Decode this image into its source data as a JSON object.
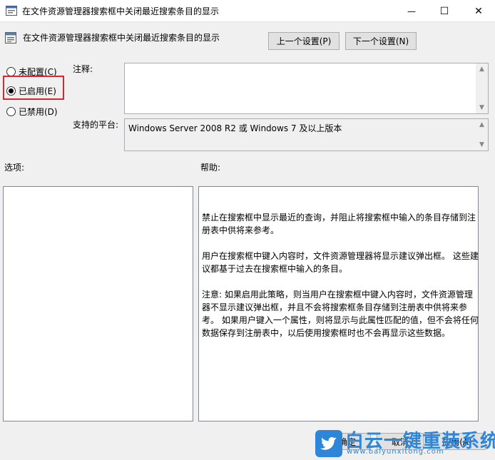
{
  "window": {
    "title": "在文件资源管理器搜索框中关闭最近搜索条目的显示",
    "minimize_glyph": "—",
    "maximize_glyph": "☐",
    "close_glyph": "✕"
  },
  "header": {
    "title": "在文件资源管理器搜索框中关闭最近搜索条目的显示",
    "prev_button": "上一个设置(P)",
    "next_button": "下一个设置(N)"
  },
  "radios": [
    {
      "label": "未配置(C)",
      "checked": false
    },
    {
      "label": "已启用(E)",
      "checked": true
    },
    {
      "label": "已禁用(D)",
      "checked": false
    }
  ],
  "comment": {
    "label": "注释:",
    "value": ""
  },
  "platform": {
    "label": "支持的平台:",
    "value": "Windows Server 2008 R2 或 Windows 7 及以上版本"
  },
  "options": {
    "label": "选项:"
  },
  "help": {
    "label": "帮助:",
    "paragraphs": [
      "禁止在搜索框中显示最近的查询，并阻止将搜索框中输入的条目存储到注册表中供将来参考。",
      "用户在搜索框中键入内容时，文件资源管理器将显示建议弹出框。 这些建议都基于过去在搜索框中输入的条目。",
      "注意: 如果启用此策略，则当用户在搜索框中键入内容时，文件资源管理器不显示建议弹出框，并且不会将搜索框条目存储到注册表中供将来参考。 如果用户键入一个属性，则将显示与此属性匹配的值，但不会将任何数据保存到注册表中，以后使用搜索框时也不会再显示这些数据。"
    ]
  },
  "footer": {
    "ok_button": "确定",
    "cancel_button": "取消",
    "apply_button": "应用(A)"
  },
  "watermark": {
    "text": "白云一键重装系统",
    "url": "www.baiyunxitong.com"
  },
  "colors": {
    "highlight": "#e0242b",
    "watermark": "#2e86d9"
  }
}
